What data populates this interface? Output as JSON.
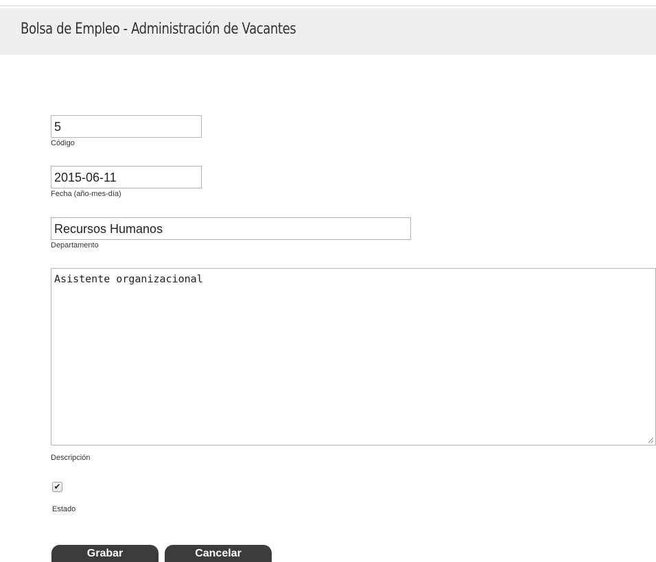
{
  "header": {
    "title": "Bolsa de Empleo - Administración de Vacantes"
  },
  "form": {
    "codigo": {
      "value": "5",
      "label": "Código"
    },
    "fecha": {
      "value": "2015-06-11",
      "label": "Fecha (año-mes-día)"
    },
    "departamento": {
      "value": "Recursos Humanos",
      "label": "Departamento"
    },
    "descripcion": {
      "value": "Asistente organizacional",
      "label": "Descripción"
    },
    "estado": {
      "checked": true,
      "label": "Estado"
    }
  },
  "buttons": {
    "save_label": "Grabar",
    "cancel_label": "Cancelar"
  },
  "colors": {
    "header_bg": "#efefef",
    "button_bg": "#3c3c3c"
  },
  "icons": {
    "checkmark": "checkmark-icon",
    "resize": "resize-grip-icon"
  }
}
